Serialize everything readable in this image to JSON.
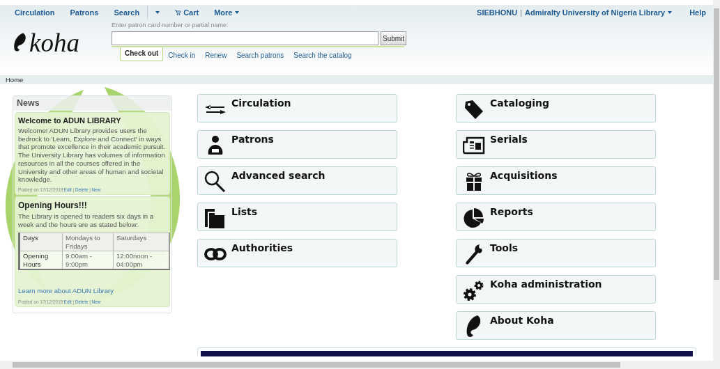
{
  "nav": {
    "left": [
      {
        "label": "Circulation",
        "kind": "link"
      },
      {
        "label": "Patrons",
        "kind": "link"
      },
      {
        "label": "Search",
        "kind": "link"
      },
      {
        "kind": "caret"
      },
      {
        "label": "Cart",
        "kind": "cart"
      },
      {
        "label": "More",
        "kind": "menu"
      }
    ],
    "user": "SIEBHONU",
    "separator": "|",
    "library": "Admiralty University of Nigeria Library",
    "help": "Help"
  },
  "logo": "koha",
  "checkout": {
    "label": "Enter patron card number or partial name:",
    "submit": "Submit",
    "tabs": [
      {
        "label": "Check out",
        "selected": true
      },
      {
        "label": "Check in",
        "selected": false
      },
      {
        "label": "Renew",
        "selected": false
      },
      {
        "label": "Search patrons",
        "selected": false
      },
      {
        "label": "Search the catalog",
        "selected": false
      }
    ]
  },
  "breadcrumb": "Home",
  "news": {
    "title": "News",
    "items": [
      {
        "title": "Welcome to ADUN LIBRARY",
        "body": "Welcome! ADUN Library provides users the bedrock to 'Learn, Explore and Connect' in ways that promote excellence in their academic pursuit. The University Library has volumes of information resources in all the courses offered in the University and other areas of human and societal knowledge.",
        "posted": "Posted on 17/12/2019",
        "actions": [
          "Edit",
          "Delete",
          "New"
        ],
        "separators": [
          "|",
          "|"
        ]
      },
      {
        "title": "Opening Hours!!!",
        "body": "The Library is opened to readers six days in a week and the hours are as stated below:",
        "table": [
          [
            "Days",
            "Mondays to Fridays",
            "Saturdays"
          ],
          [
            "Opening Hours",
            "9:00am - 9:00pm",
            "12:00noon - 04:00pm"
          ]
        ],
        "link": "Learn more about ADUN Library",
        "posted": "Posted on 17/12/2019",
        "actions": [
          "Edit",
          "Delete",
          "New"
        ],
        "separators": [
          "|",
          "|"
        ]
      }
    ]
  },
  "modules": {
    "left": [
      "Circulation",
      "Patrons",
      "Advanced search",
      "Lists",
      "Authorities"
    ],
    "right": [
      "Cataloging",
      "Serials",
      "Acquisitions",
      "Reports",
      "Tools",
      "Koha administration",
      "About Koha"
    ]
  }
}
